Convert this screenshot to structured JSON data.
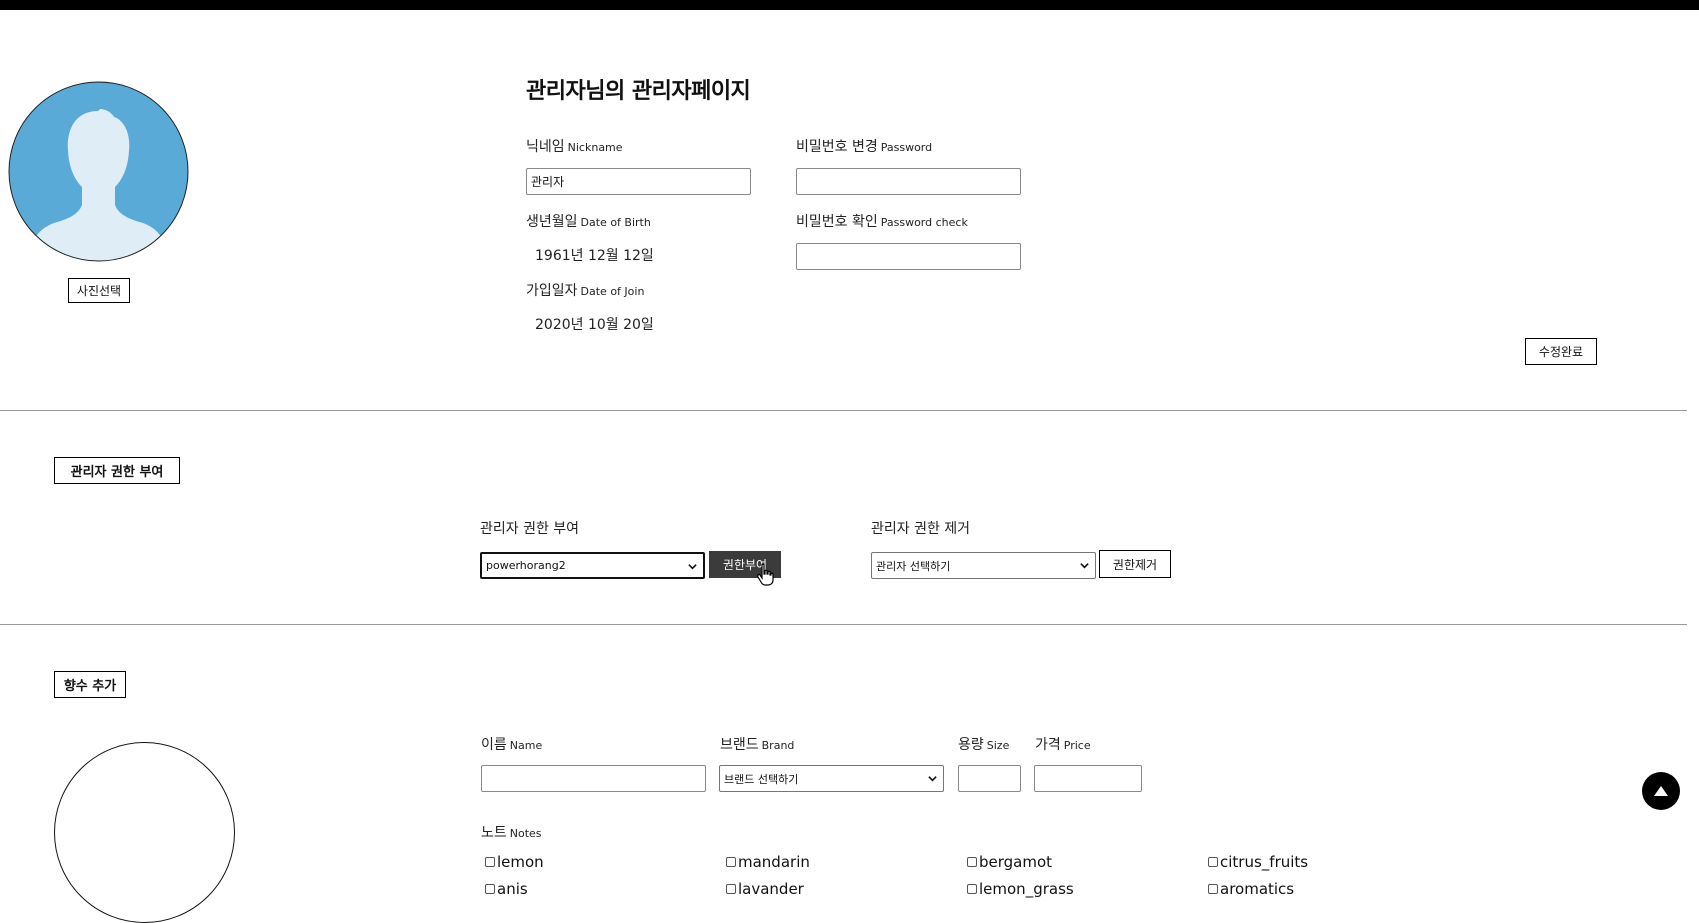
{
  "profile": {
    "page_title": "관리자님의 관리자페이지",
    "photo_button": "사진선택",
    "nickname_label": "닉네임",
    "nickname_label_en": "Nickname",
    "nickname_value": "관리자",
    "password_label": "비밀번호 변경",
    "password_label_en": "Password",
    "birth_label": "생년월일",
    "birth_label_en": "Date of Birth",
    "birth_value": "1961년 12월 12일",
    "password_check_label": "비밀번호 확인",
    "password_check_label_en": "Password check",
    "join_label": "가입일자",
    "join_label_en": "Date of Join",
    "join_value": "2020년 10월 20일",
    "save_button": "수정완료"
  },
  "admin_rights": {
    "section_title": "관리자 권한 부여",
    "grant_label": "관리자 권한 부여",
    "grant_selected": "powerhorang2",
    "grant_button": "권한부여",
    "revoke_label": "관리자 권한 제거",
    "revoke_selected": "관리자 선택하기",
    "revoke_button": "권한제거"
  },
  "perfume_add": {
    "section_title": "향수 추가",
    "name_label": "이름",
    "name_label_en": "Name",
    "brand_label": "브랜드",
    "brand_label_en": "Brand",
    "brand_selected": "브랜드 선택하기",
    "size_label": "용량",
    "size_label_en": "Size",
    "price_label": "가격",
    "price_label_en": "Price",
    "notes_label": "노트",
    "notes_label_en": "Notes",
    "notes": [
      "lemon",
      "mandarin",
      "bergamot",
      "citrus_fruits",
      "anis",
      "lavander",
      "lemon_grass",
      "aromatics"
    ]
  },
  "colors": {
    "avatar_bg": "#5aaad7",
    "avatar_figure": "#deedf6",
    "dark_button": "#3b3b3b"
  },
  "icons": {
    "scroll_top": "triangle-up-icon",
    "select_arrow": "chevron-down-icon",
    "cursor": "hand-pointer-icon"
  }
}
